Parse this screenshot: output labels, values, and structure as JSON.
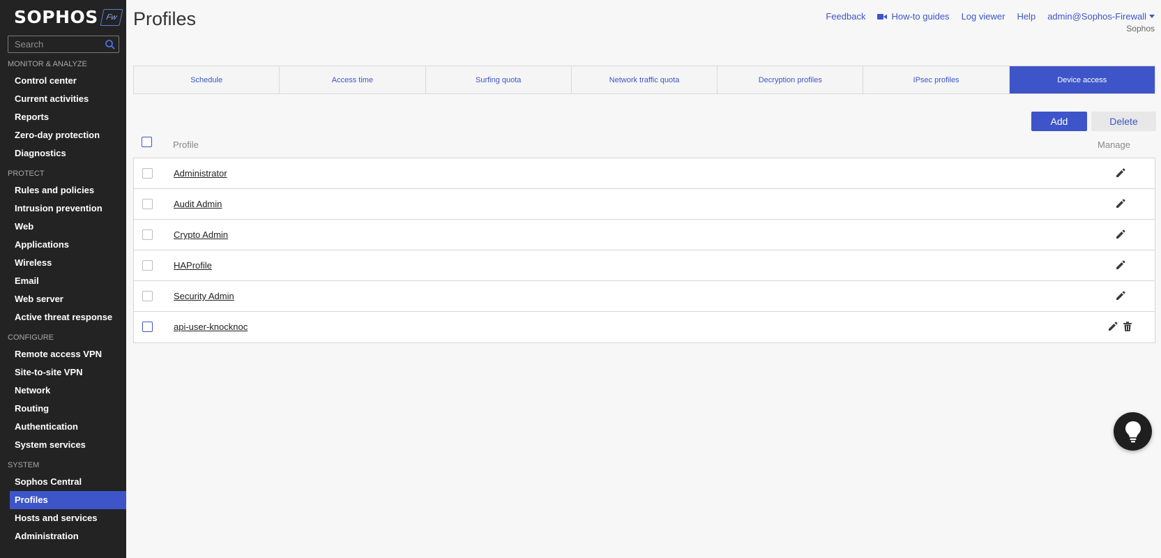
{
  "brand": {
    "logo_text": "SOPHOS",
    "badge_text": "Fw"
  },
  "search": {
    "placeholder": "Search"
  },
  "sidebar": {
    "sections": [
      {
        "label": "MONITOR & ANALYZE",
        "items": [
          "Control center",
          "Current activities",
          "Reports",
          "Zero-day protection",
          "Diagnostics"
        ]
      },
      {
        "label": "PROTECT",
        "items": [
          "Rules and policies",
          "Intrusion prevention",
          "Web",
          "Applications",
          "Wireless",
          "Email",
          "Web server",
          "Active threat response"
        ]
      },
      {
        "label": "CONFIGURE",
        "items": [
          "Remote access VPN",
          "Site-to-site VPN",
          "Network",
          "Routing",
          "Authentication",
          "System services"
        ]
      },
      {
        "label": "SYSTEM",
        "items": [
          "Sophos Central",
          "Profiles",
          "Hosts and services",
          "Administration"
        ]
      }
    ],
    "active_item": "Profiles"
  },
  "header": {
    "title": "Profiles",
    "links": {
      "feedback": "Feedback",
      "howto": "How-to guides",
      "logviewer": "Log viewer",
      "help": "Help",
      "user": "admin@Sophos-Firewall"
    },
    "org": "Sophos"
  },
  "tabs": [
    {
      "label": "Schedule",
      "active": false
    },
    {
      "label": "Access time",
      "active": false
    },
    {
      "label": "Surfing quota",
      "active": false
    },
    {
      "label": "Network traffic quota",
      "active": false
    },
    {
      "label": "Decryption profiles",
      "active": false
    },
    {
      "label": "IPsec profiles",
      "active": false
    },
    {
      "label": "Device access",
      "active": true
    }
  ],
  "actions": {
    "add": "Add",
    "delete": "Delete"
  },
  "table": {
    "columns": {
      "profile": "Profile",
      "manage": "Manage"
    },
    "rows": [
      {
        "name": "Administrator",
        "deletable": false
      },
      {
        "name": "Audit Admin",
        "deletable": false
      },
      {
        "name": "Crypto Admin",
        "deletable": false
      },
      {
        "name": "HAProfile",
        "deletable": false
      },
      {
        "name": "Security Admin",
        "deletable": false
      },
      {
        "name": "api-user-knocknoc",
        "deletable": true
      }
    ]
  },
  "colors": {
    "accent": "#3d55c9",
    "sidebar_bg": "#232323"
  },
  "icons": {
    "search": "search-icon",
    "edit": "pencil-icon",
    "delete": "trash-icon",
    "video": "video-camera-icon",
    "help": "lightbulb-icon"
  }
}
